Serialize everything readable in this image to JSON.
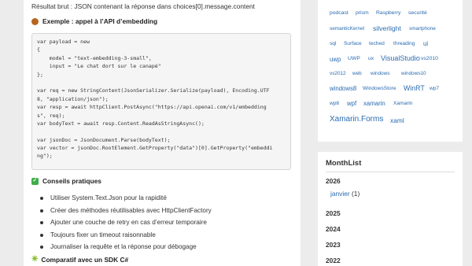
{
  "article": {
    "intro": "Résultat brut : JSON contenant la réponse dans choices[0].message.content",
    "example_heading": "Exemple : appel à l’API d’embedding",
    "code_lines": [
      "var payload = new",
      "{",
      "    model = \"text-embedding-3-small\",",
      "    input = \"Le chat dort sur le canapé\"",
      "};",
      "",
      "var req = new StringContent(JsonSerializer.Serialize(payload), Encoding.UTF",
      "8, \"application/json\");",
      "var resp = await httpClient.PostAsync(\"https://api.openai.com/v1/embedding",
      "s\", req);",
      "var bodyText = await resp.Content.ReadAsStringAsync();",
      "",
      "var jsonDoc = JsonDocument.Parse(bodyText);",
      "var vector = jsonDoc.RootElement.GetProperty(\"data\")[0].GetProperty(\"embeddi",
      "ng\");"
    ],
    "tips_heading": "Conseils pratiques",
    "tips": [
      "Utiliser System.Text.Json pour la rapidité",
      "Créer des méthodes réutilisables avec HttpClientFactory",
      "Ajouter une couche de retry en cas d’erreur temporaire",
      "Toujours fixer un timeout raisonnable",
      "Journaliser la requête et la réponse pour débogage"
    ],
    "compare_heading": "Comparatif avec un SDK C#"
  },
  "tag_cloud": {
    "tags": [
      "podcast",
      "prism",
      "Raspberry",
      "securité",
      "semanticKernel",
      "silverlight",
      "smartphone",
      "sql",
      "Surface",
      "teched",
      "threading",
      "ui",
      "uwp",
      "UWP",
      "ux",
      "VisualStudio",
      "vs2010",
      "vs2012",
      "web",
      "windows",
      "windows10",
      "windows8",
      "WindowsStore",
      "WinRT",
      "wp7",
      "wp8",
      "wpf",
      "xamarin",
      "Xamarin",
      "Xamarin.Forms",
      "xaml"
    ]
  },
  "month_list": {
    "title": "MonthList",
    "years": [
      "2026",
      "2025",
      "2024",
      "2023",
      "2022"
    ],
    "month_link": "janvier",
    "month_count": "(1)"
  },
  "colors": {
    "link": "#2a6bb0",
    "page_bg": "#ececec",
    "code_bg": "#f5f5f5"
  }
}
